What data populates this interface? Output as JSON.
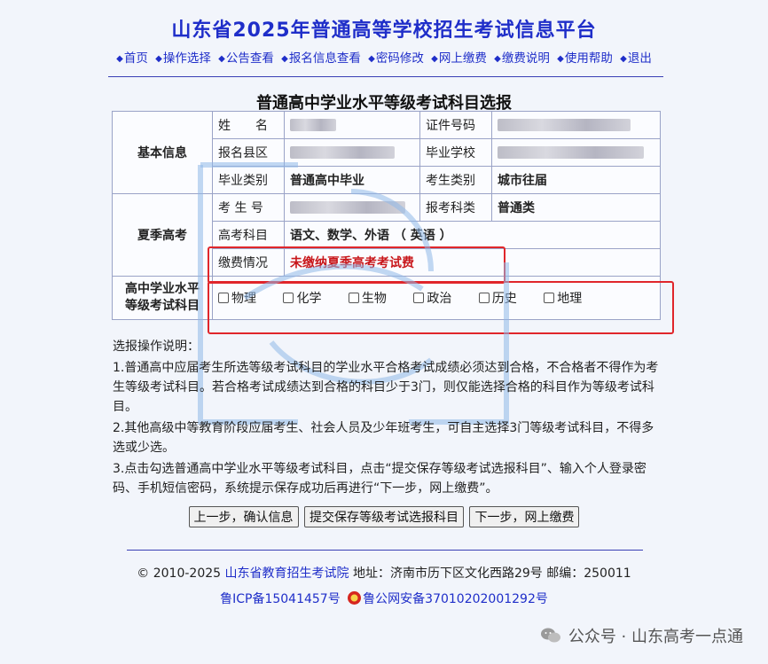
{
  "header": {
    "title": "山东省2025年普通高等学校招生考试信息平台",
    "nav": [
      "首页",
      "操作选择",
      "公告查看",
      "报名信息查看",
      "密码修改",
      "网上缴费",
      "缴费说明",
      "使用帮助",
      "退出"
    ]
  },
  "page": {
    "heading": "普通高中学业水平等级考试科目选报"
  },
  "basic_info": {
    "section": "基本信息",
    "name_label": "姓　　名",
    "id_label": "证件号码",
    "county_label": "报名县区",
    "school_label": "毕业学校",
    "grad_type_label": "毕业类别",
    "grad_type_value": "普通高中毕业",
    "exam_type_label": "考生类别",
    "exam_type_value": "城市往届"
  },
  "summer_exam": {
    "section": "夏季高考",
    "exam_no_label": "考 生 号",
    "subject_cat_label": "报考科类",
    "subject_cat_value": "普通类",
    "subjects_label": "高考科目",
    "subjects_value": "语文、数学、外语 （ 英语 ）",
    "payment_label": "缴费情况",
    "payment_value": "未缴纳夏季高考考试费"
  },
  "level_exam": {
    "section_line1": "高中学业水平",
    "section_line2": "等级考试科目",
    "subjects": [
      "物理",
      "化学",
      "生物",
      "政治",
      "历史",
      "地理"
    ]
  },
  "instructions": {
    "title": "选报操作说明：",
    "items": [
      "1.普通高中应届考生所选等级考试科目的学业水平合格考试成绩必须达到合格，不合格者不得作为考生等级考试科目。若合格考试成绩达到合格的科目少于3门，则仅能选择合格的科目作为等级考试科目。",
      "2.其他高级中等教育阶段应届考生、社会人员及少年班考生，可自主选择3门等级考试科目，不得多选或少选。",
      "3.点击勾选普通高中学业水平等级考试科目，点击“提交保存等级考试选报科目”、输入个人登录密码、手机短信密码，系统提示保存成功后再进行“下一步，网上缴费”。"
    ]
  },
  "buttons": {
    "prev": "上一步，确认信息",
    "submit": "提交保存等级考试选报科目",
    "next": "下一步，网上缴费"
  },
  "footer": {
    "copyright": "© 2010-2025",
    "org": "山东省教育招生考试院",
    "address": "地址：济南市历下区文化西路29号 邮编：250011",
    "icp": "鲁ICP备15041457号",
    "police": "鲁公网安备37010202001292号"
  },
  "wechat": {
    "text": "公众号 · 山东高考一点通"
  },
  "colors": {
    "accent": "#1f2ec9",
    "alert": "#c8171b",
    "highlight_box": "#e0262b"
  }
}
